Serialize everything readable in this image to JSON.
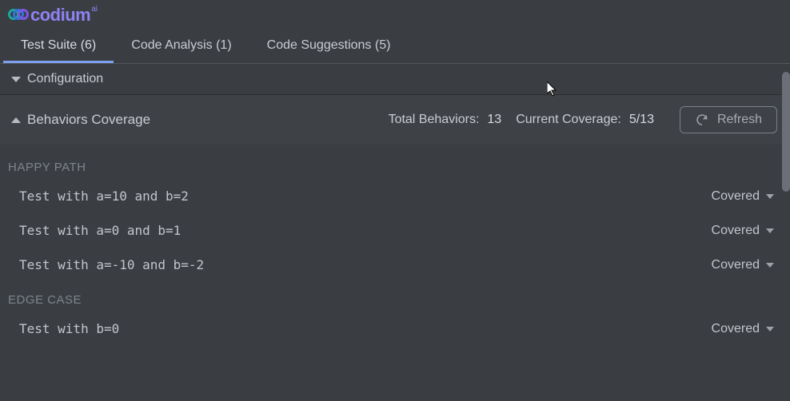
{
  "logo": {
    "text": "codium",
    "suffix": "ai"
  },
  "tabs": [
    {
      "label": "Test Suite (6)",
      "active": true
    },
    {
      "label": "Code Analysis (1)",
      "active": false
    },
    {
      "label": "Code Suggestions (5)",
      "active": false
    }
  ],
  "config_section": {
    "title": "Configuration"
  },
  "behaviors": {
    "title": "Behaviors Coverage",
    "total_label": "Total Behaviors:",
    "total_value": "13",
    "coverage_label": "Current Coverage:",
    "coverage_value": "5/13",
    "refresh_label": "Refresh"
  },
  "groups": [
    {
      "name": "HAPPY PATH",
      "items": [
        {
          "label": "Test with a=10 and b=2",
          "status": "Covered"
        },
        {
          "label": "Test with a=0 and b=1",
          "status": "Covered"
        },
        {
          "label": "Test with a=-10 and b=-2",
          "status": "Covered"
        }
      ]
    },
    {
      "name": "EDGE CASE",
      "items": [
        {
          "label": "Test with b=0",
          "status": "Covered"
        }
      ]
    }
  ]
}
